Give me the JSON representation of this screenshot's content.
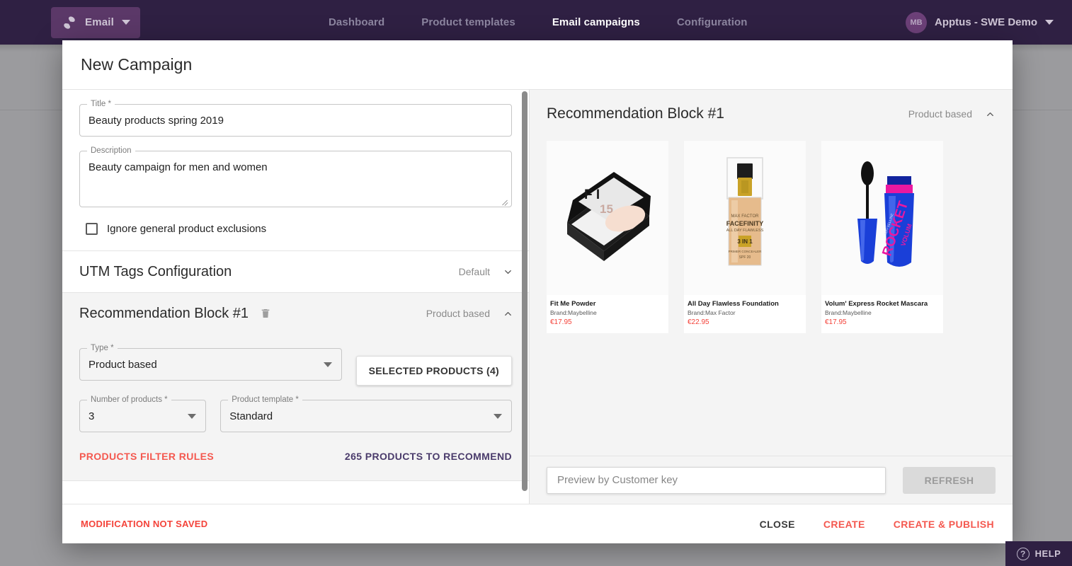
{
  "topnav": {
    "brand": {
      "label": "Email",
      "icon": "pinwheel-logo-icon",
      "caret": "chevron-down-icon"
    },
    "links": [
      {
        "label": "Dashboard",
        "active": false
      },
      {
        "label": "Product templates",
        "active": false
      },
      {
        "label": "Email campaigns",
        "active": true
      },
      {
        "label": "Configuration",
        "active": false
      }
    ],
    "account": {
      "initials": "MB",
      "name": "Apptus - SWE Demo"
    },
    "colors": {
      "bar": "#2f2043",
      "pill": "#5b3868",
      "muted": "#8d86a0",
      "active": "#ffffff"
    }
  },
  "modal": {
    "title": "New Campaign",
    "form": {
      "title_field": {
        "label": "Title *",
        "value": "Beauty products spring 2019"
      },
      "description_field": {
        "label": "Description",
        "value": "Beauty campaign for men and women"
      },
      "ignore_exclusions": {
        "label": "Ignore general product exclusions",
        "checked": false
      }
    },
    "utm_section": {
      "title": "UTM Tags Configuration",
      "status": "Default",
      "expanded": false
    },
    "block_section": {
      "title": "Recommendation Block #1",
      "status": "Product based",
      "expanded": true,
      "type_field": {
        "label": "Type *",
        "value": "Product based"
      },
      "selected_products_button": "SELECTED PRODUCTS (4)",
      "number_field": {
        "label": "Number of products *",
        "value": "3"
      },
      "template_field": {
        "label": "Product template *",
        "value": "Standard"
      },
      "filter_rules_link": "PRODUCTS FILTER RULES",
      "recommend_count_link": "265 PRODUCTS TO RECOMMEND"
    },
    "footer": {
      "status": "MODIFICATION NOT SAVED",
      "close": "CLOSE",
      "create": "CREATE",
      "create_publish": "CREATE & PUBLISH"
    }
  },
  "preview": {
    "title": "Recommendation Block #1",
    "status": "Product based",
    "expanded": true,
    "products": [
      {
        "name": "Fit Me Powder",
        "brand": "Brand:Maybelline",
        "price": "€17.95",
        "image": "compact-powder-image"
      },
      {
        "name": "All Day Flawless Foundation",
        "brand": "Brand:Max Factor",
        "price": "€22.95",
        "image": "foundation-bottle-image"
      },
      {
        "name": "Volum' Express Rocket Mascara",
        "brand": "Brand:Maybelline",
        "price": "€17.95",
        "image": "mascara-tube-image"
      }
    ],
    "customer_key_placeholder": "Preview by Customer key",
    "customer_key_value": "",
    "refresh_button": "REFRESH",
    "refresh_disabled": true
  },
  "help": {
    "label": "HELP",
    "icon": "question-circle-icon"
  },
  "colors": {
    "accent_red": "#f4584f",
    "price_red": "#f4433a",
    "purple": "#4a3b6b"
  }
}
